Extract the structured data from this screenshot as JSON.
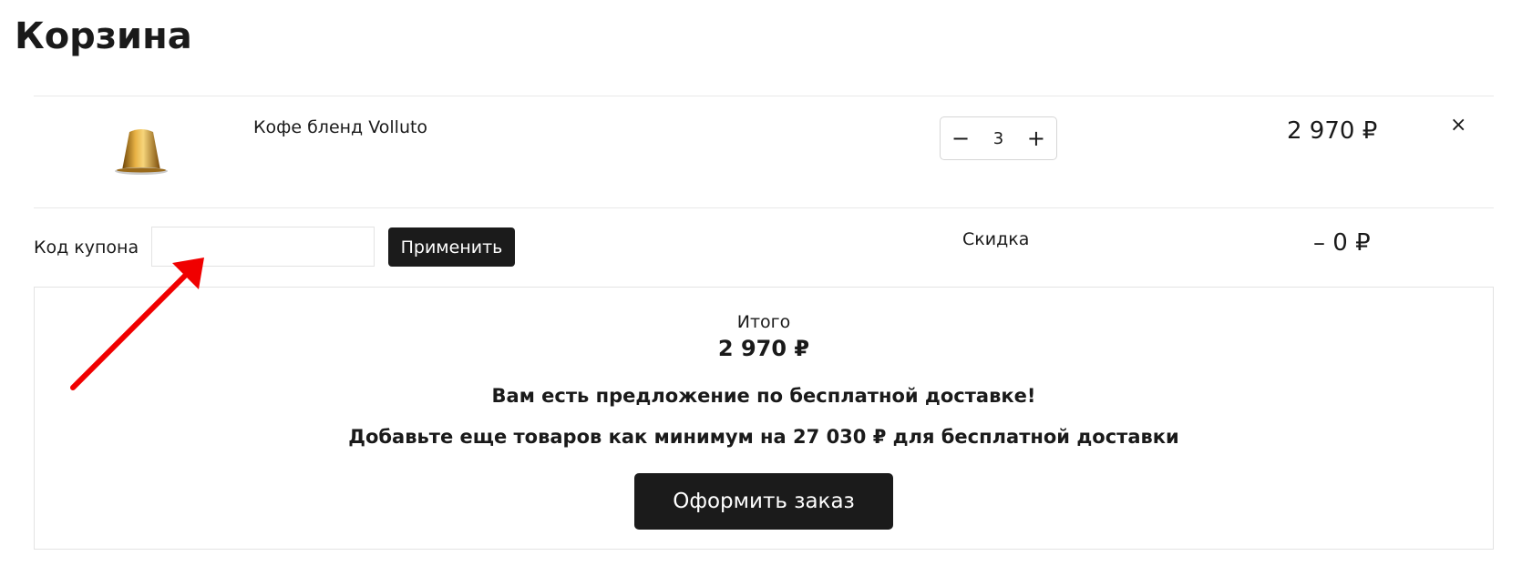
{
  "page": {
    "title": "Корзина"
  },
  "cart": {
    "item": {
      "name": "Кофе бленд Volluto",
      "quantity": "3",
      "minus": "−",
      "plus": "+",
      "price": "2 970 ₽",
      "remove": "×"
    },
    "coupon": {
      "label": "Код купона",
      "value": "",
      "apply_label": "Применить"
    },
    "discount": {
      "label": "Скидка",
      "value": "– 0 ₽"
    }
  },
  "summary": {
    "total_label": "Итого",
    "total_value": "2 970 ₽",
    "offer_text": "Вам есть предложение по бесплатной доставке!",
    "add_more_text": "Добавьте еще товаров как минимум на 27 030 ₽ для бесплатной доставки",
    "checkout_label": "Оформить заказ"
  },
  "colors": {
    "button_bg": "#1b1b1b",
    "annotation_arrow": "#f00000",
    "capsule": "#c08a1e"
  },
  "icons": {
    "product": "coffee-capsule-icon",
    "annotation": "red-arrow-icon"
  }
}
